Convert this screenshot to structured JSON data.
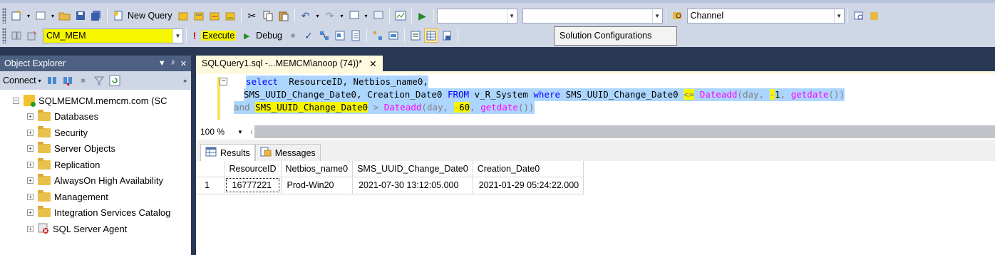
{
  "toolbar1": {
    "new_query_label": "New Query",
    "combo_empty_1": "",
    "combo_empty_2": "",
    "channel_value": "Channel",
    "icons": [
      "new-project-icon",
      "open-file-icon",
      "save-icon",
      "save-all-icon",
      "new-query-icon",
      "database-engine-query-icon",
      "analysis-query-icon",
      "cut-icon",
      "copy-icon",
      "paste-icon",
      "undo-icon",
      "redo-icon",
      "start-icon"
    ]
  },
  "toolbar2": {
    "database_value": "CM_MEM",
    "execute_label": "Execute",
    "debug_label": "Debug",
    "tooltip": "Solution Configurations"
  },
  "object_explorer": {
    "title": "Object Explorer",
    "connect_label": "Connect",
    "server_label": "SQLMEMCM.memcm.com (SC",
    "nodes": [
      {
        "label": "Databases"
      },
      {
        "label": "Security"
      },
      {
        "label": "Server Objects"
      },
      {
        "label": "Replication"
      },
      {
        "label": "AlwaysOn High Availability"
      },
      {
        "label": "Management"
      },
      {
        "label": "Integration Services Catalog"
      },
      {
        "label": "SQL Server Agent"
      }
    ]
  },
  "query_tab": {
    "label": "SQLQuery1.sql -...MEMCM\\anoop (74))*",
    "close": "✕"
  },
  "editor": {
    "line1": {
      "kw": "select",
      "rest": "  ResourceID, Netbios_name0,"
    },
    "line2": {
      "a": "SMS_UUID_Change_Date0, Creation_Date0 ",
      "from": "FROM",
      "b": " v_R_System ",
      "where": "where",
      "c": " SMS_UUID_Change_Date0 ",
      "op": "<=",
      "fn": " Dateadd",
      "d": "(day, ",
      "minus": "-",
      "num": "1",
      "e": ", ",
      "fn2": "getdate",
      "f": "())"
    },
    "line3": {
      "and": "and",
      "col": "SMS_UUID_Change_Date0",
      "op": " > ",
      "fn": "Dateadd",
      "d": "(day, ",
      "minus": "-",
      "num": "60",
      "e": ", ",
      "fn2": "getdate",
      "f": "())"
    }
  },
  "zoom": {
    "value": "100 %"
  },
  "results": {
    "tabs": [
      "Results",
      "Messages"
    ],
    "columns": [
      "ResourceID",
      "Netbios_name0",
      "SMS_UUID_Change_Date0",
      "Creation_Date0"
    ],
    "rows": [
      {
        "n": "1",
        "cells": [
          "16777221",
          "Prod-Win20",
          "2021-07-30 13:12:05.000",
          "2021-01-29 05:24:22.000"
        ]
      }
    ]
  }
}
